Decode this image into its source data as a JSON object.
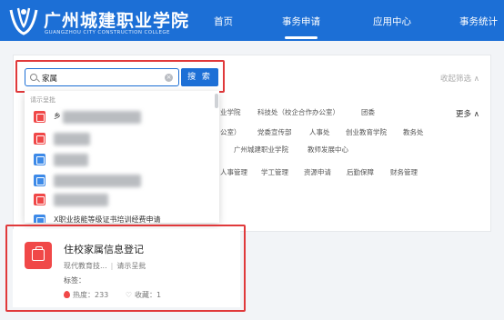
{
  "header": {
    "title": "广州城建职业学院",
    "subtitle": "GUANGZHOU CITY CONSTRUCTION COLLEGE",
    "nav": [
      "首页",
      "事务申请",
      "应用中心",
      "事务统计"
    ],
    "active_nav": "事务申请",
    "brand_color": "#1c6fd6"
  },
  "filter": {
    "collapse_label": "收起筛选",
    "more_label": "更多",
    "row1": [
      "业学院",
      "科技处（校企合作办公室）",
      "团委"
    ],
    "row2": [
      "公室）",
      "党委宣传部",
      "人事处",
      "创业教育学院",
      "教务处"
    ],
    "row3": [
      "广州城建职业学院",
      "教师发展中心"
    ],
    "row4": [
      "人事管理",
      "学工管理",
      "资源申请",
      "后勤保障",
      "财务管理"
    ]
  },
  "search": {
    "value": "家属",
    "button_label": "搜 索",
    "dropdown_header": "请示呈批",
    "item_peek_1": "乡",
    "item_peek_last": "X职业技能等级证书培训经费申请",
    "icon_colors": [
      "#f04848",
      "#f04848",
      "#3d8ae8",
      "#3d8ae8",
      "#f04848",
      "#3d8ae8"
    ]
  },
  "card": {
    "title": "住校家属信息登记",
    "dept": "现代教育技...",
    "category": "请示呈批",
    "label_text": "标签：",
    "hot_label": "热度：",
    "hot_value": "233",
    "fav_label": "收藏：",
    "fav_value": "1"
  }
}
